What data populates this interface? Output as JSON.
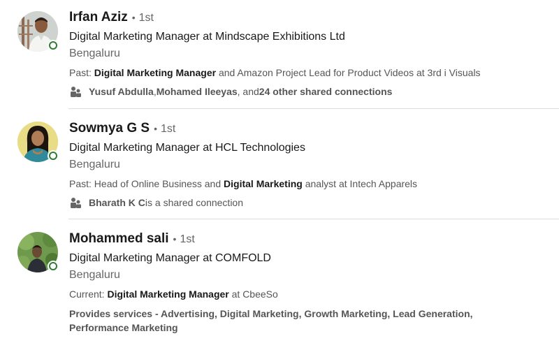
{
  "results": [
    {
      "name": "Irfan Aziz",
      "separator": "•",
      "degree": "1st",
      "headline": "Digital Marketing Manager at Mindscape Exhibitions Ltd",
      "location": "Bengaluru",
      "summary": {
        "prefix": "Past: ",
        "highlight": "Digital Marketing Manager",
        "suffix": " and Amazon Project Lead for Product Videos at 3rd i Visuals"
      },
      "shared": {
        "name1": "Yusuf Abdulla",
        "comma": ", ",
        "name2": "Mohamed Ileeyas",
        "and": ", and ",
        "count_text": "24 other shared connections"
      }
    },
    {
      "name": "Sowmya G S",
      "separator": "•",
      "degree": "1st",
      "headline": "Digital Marketing Manager at HCL Technologies",
      "location": "Bengaluru",
      "summary": {
        "prefix": "Past: Head of Online Business and ",
        "highlight": "Digital Marketing",
        "suffix": " analyst at Intech Apparels"
      },
      "shared": {
        "name1": "Bharath K C",
        "rest": " is a shared connection"
      }
    },
    {
      "name": "Mohammed sali",
      "separator": "•",
      "degree": "1st",
      "headline": "Digital Marketing Manager at COMFOLD",
      "location": "Bengaluru",
      "summary": {
        "prefix": "Current: ",
        "highlight": "Digital Marketing Manager",
        "suffix": " at CbeeSo"
      },
      "services": "Provides services - Advertising, Digital Marketing, Growth Marketing, Lead Generation, Performance Marketing"
    }
  ],
  "icons": {
    "presence": "online-status-icon",
    "shared": "people-icon"
  },
  "colors": {
    "presence_green": "#2e7d32",
    "text_primary": "#191919",
    "text_secondary": "#666666"
  }
}
